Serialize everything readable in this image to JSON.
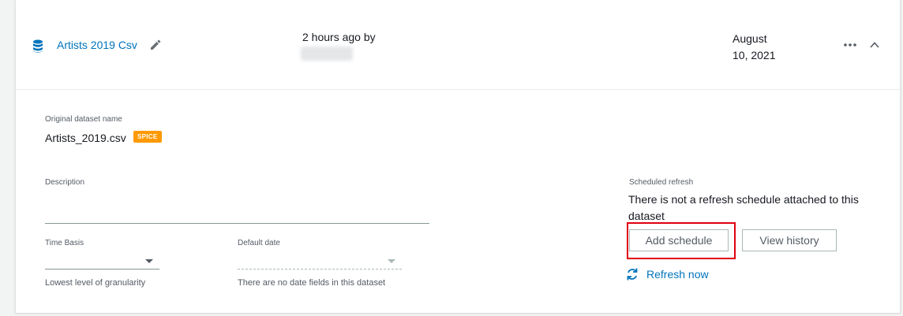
{
  "dataset": {
    "name": "Artists 2019 Csv",
    "updated_label": "2 hours ago by",
    "date_line1": "August",
    "date_line2": "10, 2021"
  },
  "details": {
    "original_name_label": "Original dataset name",
    "original_name": "Artists_2019.csv",
    "spice_badge": "SPICE",
    "description_label": "Description",
    "time_basis_label": "Time Basis",
    "time_basis_hint": "Lowest level of granularity",
    "default_date_label": "Default date",
    "default_date_hint": "There are no date fields in this dataset"
  },
  "schedule": {
    "label": "Scheduled refresh",
    "text": "There is not a refresh schedule attached to this dataset",
    "add_button": "Add schedule",
    "history_button": "View history",
    "refresh_now": "Refresh now"
  },
  "colors": {
    "link": "#0073bb",
    "badge": "#ff9900",
    "highlight": "#e0000f"
  }
}
